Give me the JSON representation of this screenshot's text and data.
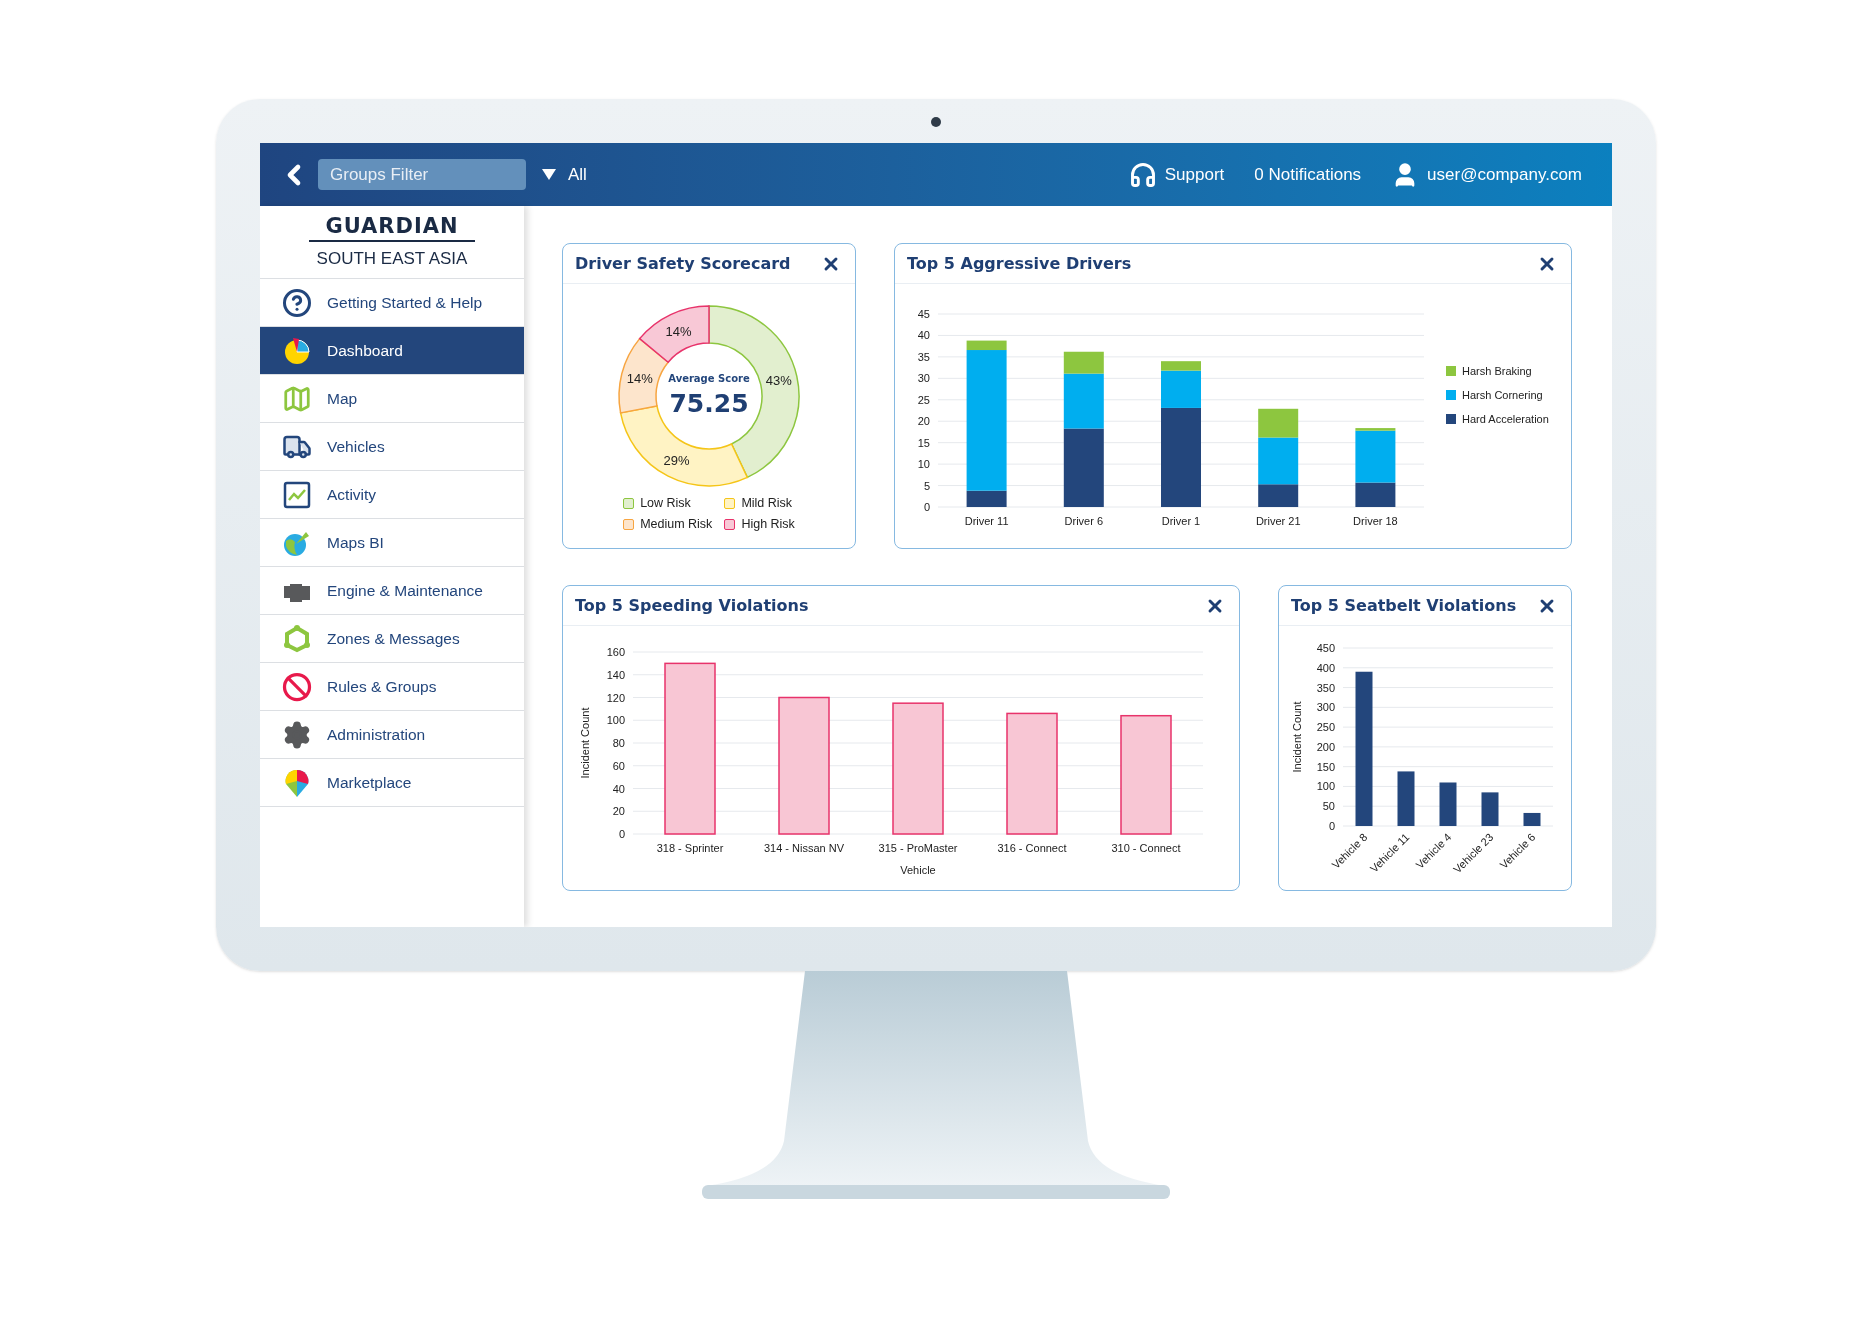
{
  "top_bar": {
    "groups_filter": {
      "placeholder": "Groups Filter"
    },
    "group_select": {
      "value": "All"
    },
    "support": "Support",
    "notifications": "0 Notifications",
    "user": "user@company.com"
  },
  "brand": {
    "name": "GUARDIAN",
    "region": "SOUTH EAST ASIA"
  },
  "sidebar": {
    "items": [
      {
        "label": "Getting Started & Help",
        "selected": false
      },
      {
        "label": "Dashboard",
        "selected": true
      },
      {
        "label": "Map",
        "selected": false
      },
      {
        "label": "Vehicles",
        "selected": false
      },
      {
        "label": "Activity",
        "selected": false
      },
      {
        "label": "Maps BI",
        "selected": false
      },
      {
        "label": "Engine & Maintenance",
        "selected": false
      },
      {
        "label": "Zones & Messages",
        "selected": false
      },
      {
        "label": "Rules & Groups",
        "selected": false
      },
      {
        "label": "Administration",
        "selected": false
      },
      {
        "label": "Marketplace",
        "selected": false
      }
    ]
  },
  "widgets": [
    {
      "title": "Driver Safety Scorecard",
      "center_label": "Average Score",
      "center_value": "75.25",
      "chart_data": {
        "type": "donut",
        "categories": [
          "Low Risk",
          "Mild Risk",
          "Medium Risk",
          "High Risk"
        ],
        "values": [
          43,
          29,
          14,
          14
        ],
        "value_labels": [
          "43%",
          "29%",
          "14%",
          "14%"
        ]
      }
    },
    {
      "kind": "stacked",
      "title": "Top 5 Aggressive Drivers",
      "chart_data": {
        "type": "bar",
        "stacked": true,
        "grid": true,
        "legend": "right",
        "categories": [
          "Driver 11",
          "Driver 6",
          "Driver 1",
          "Driver 21",
          "Driver 18"
        ],
        "ylim": [
          0,
          45
        ],
        "yticks": [
          0,
          5,
          10,
          15,
          20,
          25,
          30,
          35,
          40,
          45
        ],
        "series": [
          {
            "name": "Harsh Braking",
            "color": "#8dc63f",
            "values": [
              2.2,
              5.1,
              2.2,
              6.7,
              0.6
            ]
          },
          {
            "name": "Harsh Cornering",
            "color": "#00aeef",
            "values": [
              32.8,
              12.8,
              8.7,
              10.9,
              12.1
            ]
          },
          {
            "name": "Hard Acceleration",
            "color": "#23467c",
            "values": [
              3.8,
              18.3,
              23.1,
              5.3,
              5.7
            ]
          }
        ]
      }
    },
    {
      "kind": "bars",
      "title": "Top 5 Speeding Violations",
      "chart_data": {
        "type": "bar",
        "grid": true,
        "categories": [
          "318 - Sprinter",
          "314 - Nissan NV",
          "315 - ProMaster",
          "316 - Connect",
          "310 - Connect"
        ],
        "xlabel": "Vehicle",
        "ylabel": "Incident Count",
        "ylim": [
          0,
          160
        ],
        "yticks": [
          0,
          20,
          40,
          60,
          80,
          100,
          120,
          140,
          160
        ],
        "series": [
          {
            "color": "#f8c6d4",
            "values": [
              150,
              120,
              115,
              106,
              104
            ]
          }
        ]
      }
    },
    {
      "kind": "rotated",
      "title": "Top 5 Seatbelt Violations",
      "chart_data": {
        "type": "bar",
        "grid": true,
        "categories": [
          "Vehicle 8",
          "Vehicle 11",
          "Vehicle 4",
          "Vehicle 23",
          "Vehicle 6"
        ],
        "ylabel": "Incident Count",
        "ylim": [
          0,
          450
        ],
        "yticks": [
          0,
          50,
          100,
          150,
          200,
          250,
          300,
          350,
          400,
          450
        ],
        "series": [
          {
            "color": "#23467c",
            "values": [
              390,
              138,
              110,
              85,
              33
            ]
          }
        ]
      }
    }
  ]
}
